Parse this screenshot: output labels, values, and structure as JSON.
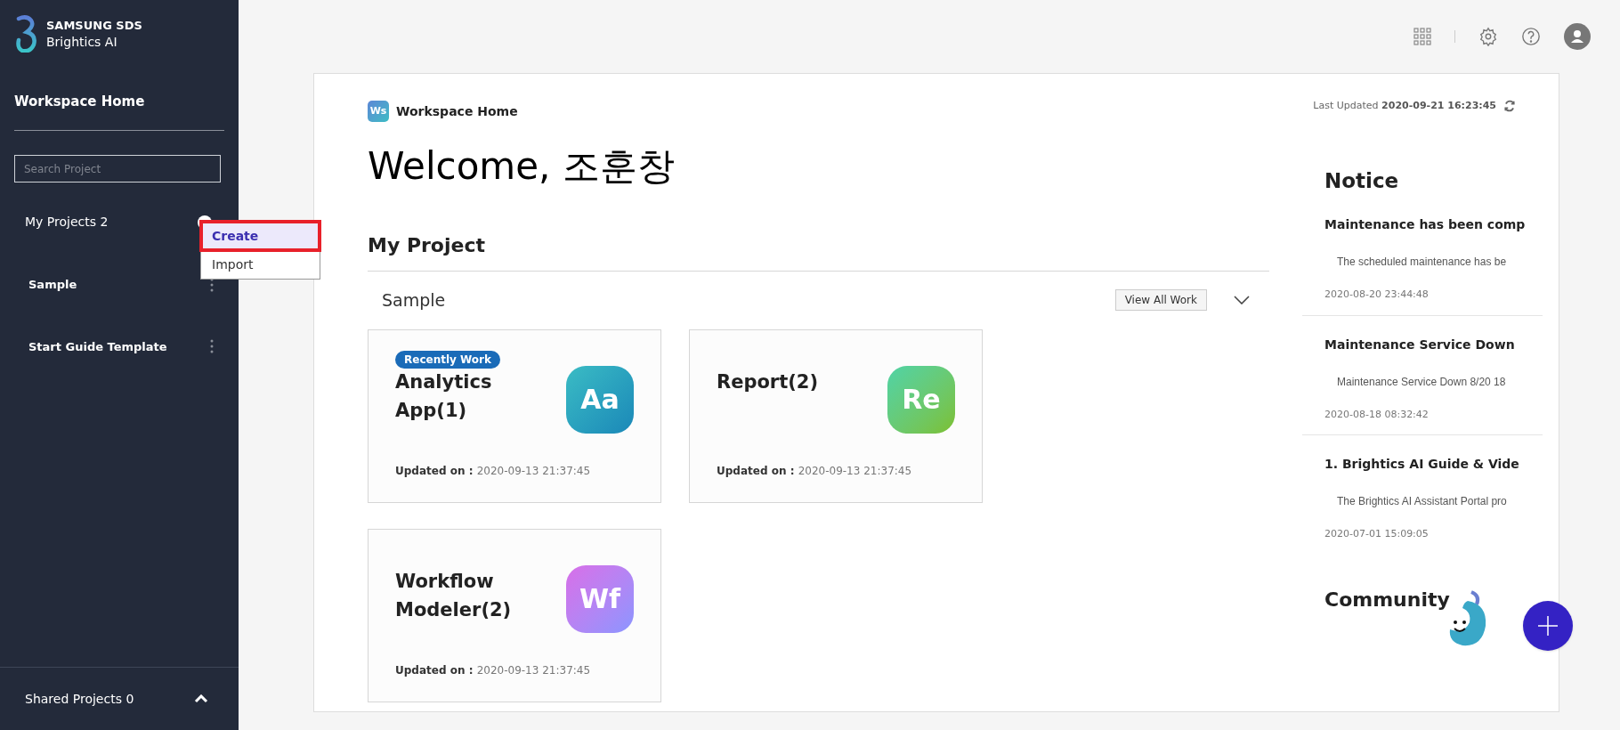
{
  "brand": {
    "company": "SAMSUNG SDS",
    "product": "Brightics AI"
  },
  "sidebar": {
    "title": "Workspace Home",
    "search": {
      "placeholder": "Search Project"
    },
    "my_projects": {
      "label": "My Projects",
      "count": "2"
    },
    "projects": [
      {
        "name": "Sample"
      },
      {
        "name": "Start Guide Template"
      }
    ],
    "shared_projects": {
      "label": "Shared Projects",
      "count": "0",
      "expanded": true
    }
  },
  "create_menu": [
    {
      "label": "Create",
      "selected": true
    },
    {
      "label": "Import",
      "selected": false
    }
  ],
  "breadcrumb": {
    "badge": "Ws",
    "label": "Workspace Home"
  },
  "last_updated": {
    "label": "Last Updated",
    "value": "2020-09-21 16:23:45"
  },
  "welcome": "Welcome, 조훈창",
  "my_project": {
    "title": "My Project",
    "project": "Sample",
    "view_all": "View All Work",
    "expanded": true,
    "cards": [
      {
        "title": "Analytics App(1)",
        "badge": "Recently Work",
        "icon": "Aa",
        "kind": "app",
        "updated_label": "Updated on :",
        "updated": "2020-09-13 21:37:45"
      },
      {
        "title": "Report(2)",
        "icon": "Re",
        "kind": "report",
        "updated_label": "Updated on :",
        "updated": "2020-09-13 21:37:45"
      },
      {
        "title": "Workflow Modeler(2)",
        "icon": "Wf",
        "kind": "workflow",
        "updated_label": "Updated on :",
        "updated": "2020-09-13 21:37:45"
      }
    ]
  },
  "notice": {
    "title": "Notice",
    "items": [
      {
        "title": "Maintenance has been comp",
        "body": "The scheduled maintenance has be",
        "date": "2020-08-20 23:44:48"
      },
      {
        "title": "Maintenance Service Down",
        "body": "Maintenance Service Down 8/20 18",
        "date": "2020-08-18 08:32:42"
      },
      {
        "title": "1. Brightics AI Guide & Vide",
        "body": "The Brightics AI Assistant Portal pro",
        "date": "2020-07-01 15:09:05"
      }
    ]
  },
  "community": {
    "title": "Community"
  }
}
